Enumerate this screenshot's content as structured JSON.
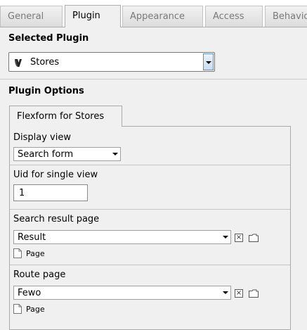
{
  "tabs": [
    {
      "label": "General",
      "active": false
    },
    {
      "label": "Plugin",
      "active": true
    },
    {
      "label": "Appearance",
      "active": false
    },
    {
      "label": "Access",
      "active": false
    },
    {
      "label": "Behavior",
      "active": false
    }
  ],
  "selected_plugin": {
    "heading": "Selected Plugin",
    "value": "Stores",
    "icon": "typo3-logo-icon"
  },
  "plugin_options": {
    "heading": "Plugin Options",
    "flexform_tab": "Flexform for Stores",
    "fields": {
      "display_view": {
        "label": "Display view",
        "value": "Search form"
      },
      "uid_single": {
        "label": "Uid for single view",
        "value": "1"
      },
      "search_result": {
        "label": "Search result page",
        "value": "Result",
        "type_label": "Page"
      },
      "route_page": {
        "label": "Route page",
        "value": "Fewo",
        "type_label": "Page"
      }
    }
  },
  "colors": {
    "background": "#f0f0f0",
    "active_tab": "#f0f0f0",
    "dropdown_button": "#c9dcf1"
  }
}
